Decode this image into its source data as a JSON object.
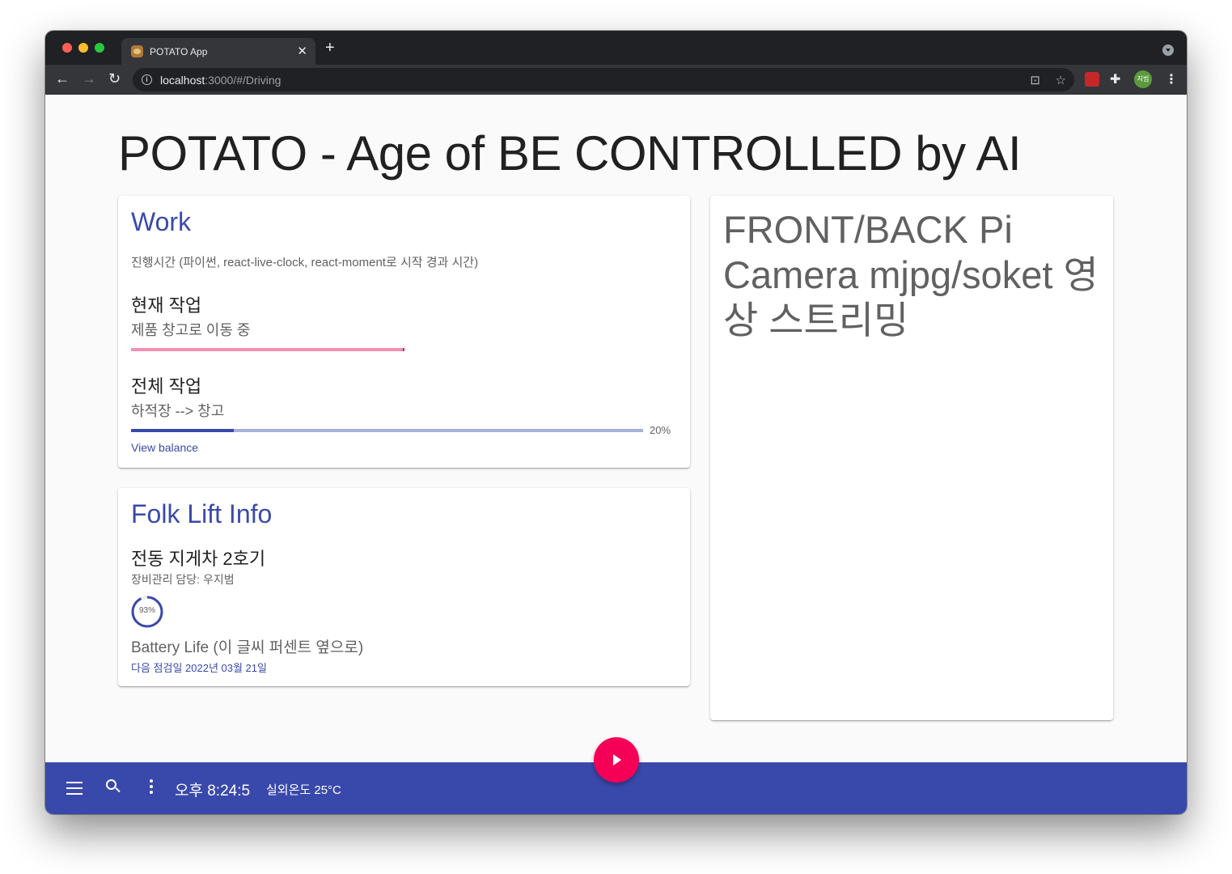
{
  "browser": {
    "tab_title": "POTATO App",
    "close_glyph": "✕",
    "new_tab_glyph": "+",
    "url_host": "localhost",
    "url_rest": ":3000/#/Driving",
    "extension_avatar": "지범"
  },
  "page": {
    "title": "POTATO - Age of BE CONTROLLED by AI"
  },
  "work": {
    "heading": "Work",
    "subtitle": "진행시간 (파이썬, react-live-clock, react-moment로 시작 경과 시간)",
    "current_label": "현재 작업",
    "current_value": "제품 창고로 이동 중",
    "total_label": "전체 작업",
    "total_value": "하적장 --> 창고",
    "progress_percent": 20,
    "progress_text": "20%",
    "link": "View balance"
  },
  "folk_lift": {
    "heading": "Folk Lift Info",
    "name": "전동 지게차 2호기",
    "manager": "장비관리 담당: 우지범",
    "battery_percent": 93,
    "battery_text": "93%",
    "battery_label": "Battery Life (이 글씨 퍼센트 옆으로)",
    "next_inspection": "다음 점검일 2022년 03월 21일"
  },
  "camera": {
    "text": "FRONT/BACK Pi Camera mjpg/soket 영상 스트리밍"
  },
  "app_bar": {
    "clock": "오후 8:24:5",
    "temperature": "실외온도 25°C"
  },
  "colors": {
    "primary": "#3949ab",
    "accent": "#f50057",
    "progress_pink": "#f48fb1"
  }
}
